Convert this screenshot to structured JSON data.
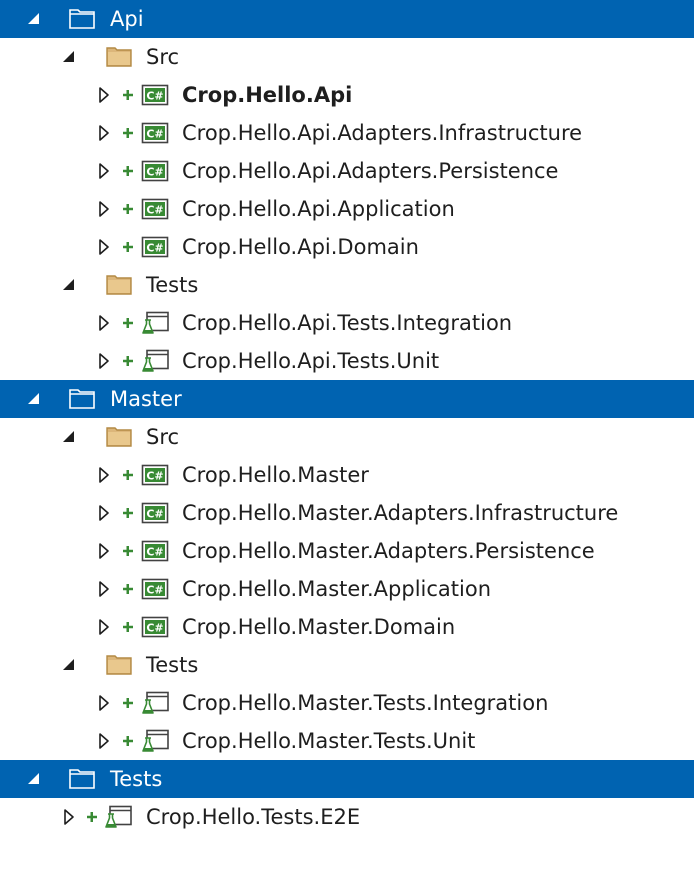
{
  "colors": {
    "selection": "#0063b1",
    "text": "#1e1e1e",
    "selected_text": "#ffffff",
    "folder": "#dcb67a",
    "csharp": "#388a34",
    "plus": "#388a34",
    "test_flask": "#388a34"
  },
  "tree": [
    {
      "label": "Api",
      "type": "solution-folder",
      "level": 0,
      "expanded": true,
      "selected": true
    },
    {
      "label": "Src",
      "type": "folder",
      "level": 1,
      "expanded": true
    },
    {
      "label": "Crop.Hello.Api",
      "type": "csharp-project",
      "level": 2,
      "collapsed": true,
      "bold": true
    },
    {
      "label": "Crop.Hello.Api.Adapters.Infrastructure",
      "type": "csharp-project",
      "level": 2,
      "collapsed": true
    },
    {
      "label": "Crop.Hello.Api.Adapters.Persistence",
      "type": "csharp-project",
      "level": 2,
      "collapsed": true
    },
    {
      "label": "Crop.Hello.Api.Application",
      "type": "csharp-project",
      "level": 2,
      "collapsed": true
    },
    {
      "label": "Crop.Hello.Api.Domain",
      "type": "csharp-project",
      "level": 2,
      "collapsed": true
    },
    {
      "label": "Tests",
      "type": "folder",
      "level": 1,
      "expanded": true
    },
    {
      "label": "Crop.Hello.Api.Tests.Integration",
      "type": "test-project",
      "level": 2,
      "collapsed": true
    },
    {
      "label": "Crop.Hello.Api.Tests.Unit",
      "type": "test-project",
      "level": 2,
      "collapsed": true
    },
    {
      "label": "Master",
      "type": "solution-folder",
      "level": 0,
      "expanded": true,
      "selected": true
    },
    {
      "label": "Src",
      "type": "folder",
      "level": 1,
      "expanded": true
    },
    {
      "label": "Crop.Hello.Master",
      "type": "csharp-project",
      "level": 2,
      "collapsed": true
    },
    {
      "label": "Crop.Hello.Master.Adapters.Infrastructure",
      "type": "csharp-project",
      "level": 2,
      "collapsed": true
    },
    {
      "label": "Crop.Hello.Master.Adapters.Persistence",
      "type": "csharp-project",
      "level": 2,
      "collapsed": true
    },
    {
      "label": "Crop.Hello.Master.Application",
      "type": "csharp-project",
      "level": 2,
      "collapsed": true
    },
    {
      "label": "Crop.Hello.Master.Domain",
      "type": "csharp-project",
      "level": 2,
      "collapsed": true
    },
    {
      "label": "Tests",
      "type": "folder",
      "level": 1,
      "expanded": true
    },
    {
      "label": "Crop.Hello.Master.Tests.Integration",
      "type": "test-project",
      "level": 2,
      "collapsed": true
    },
    {
      "label": "Crop.Hello.Master.Tests.Unit",
      "type": "test-project",
      "level": 2,
      "collapsed": true
    },
    {
      "label": "Tests",
      "type": "solution-folder",
      "level": 0,
      "expanded": true,
      "selected": true
    },
    {
      "label": "Crop.Hello.Tests.E2E",
      "type": "test-project",
      "level": 1,
      "collapsed": true
    }
  ]
}
